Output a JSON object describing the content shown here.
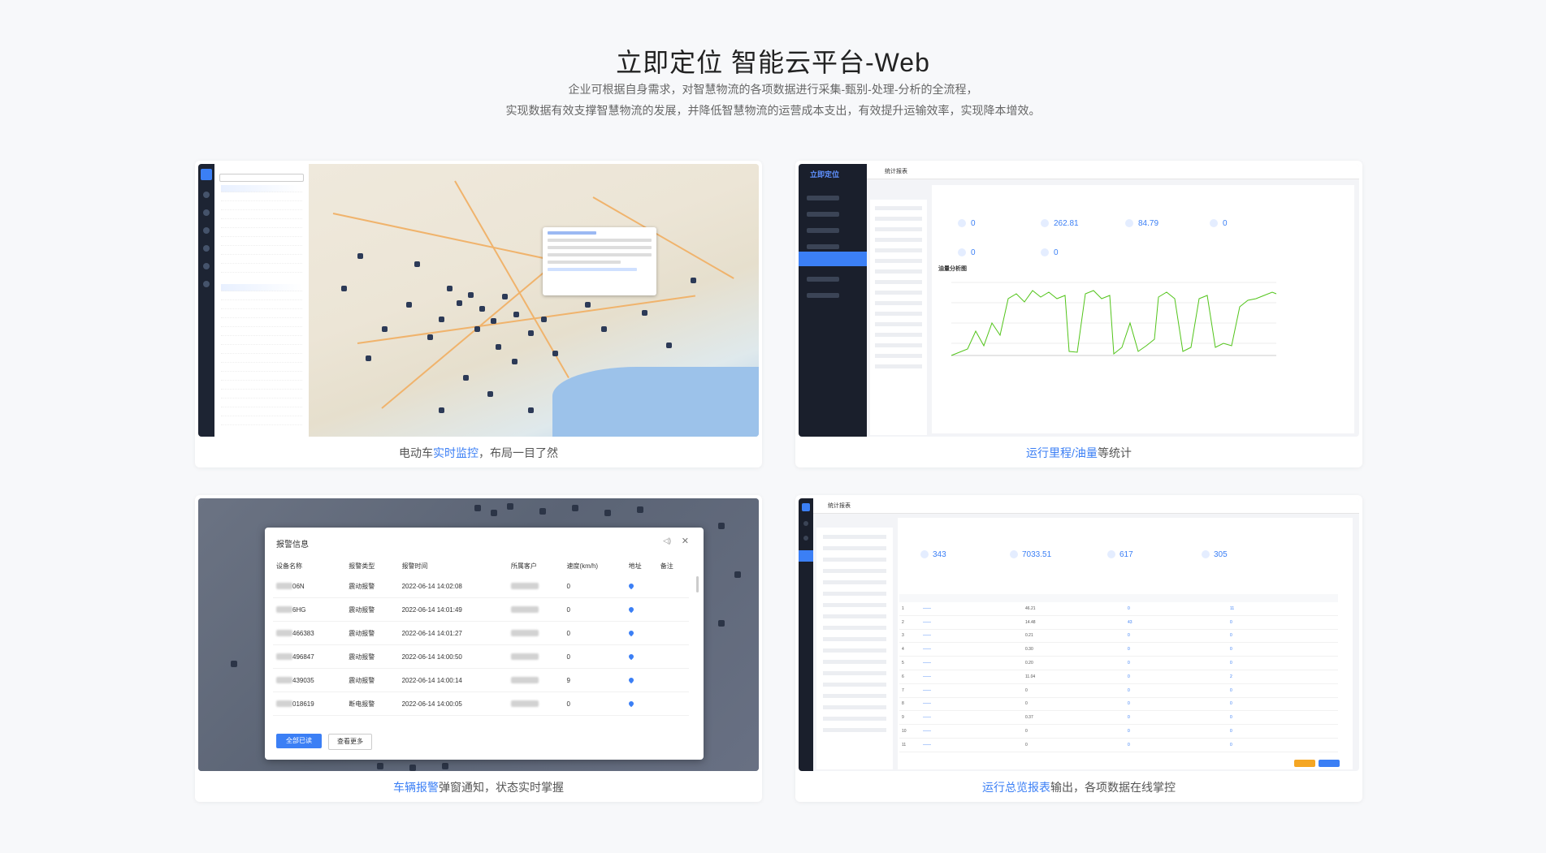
{
  "header": {
    "title": "立即定位 智能云平台-Web",
    "subtitle_line1": "企业可根据自身需求，对智慧物流的各项数据进行采集-甄别-处理-分析的全流程，",
    "subtitle_line2": "实现数据有效支撑智慧物流的发展，并降低智慧物流的运营成本支出，有效提升运输效率，实现降本增效。"
  },
  "cards": [
    {
      "caption_pre": "电动车",
      "caption_hl": "实时监控",
      "caption_post": "，布局一目了然"
    },
    {
      "caption_pre": "",
      "caption_hl": "运行里程/油量",
      "caption_post": "等统计"
    },
    {
      "caption_pre": "",
      "caption_hl": "车辆报警",
      "caption_post": "弹窗通知，状态实时掌握"
    },
    {
      "caption_pre": "",
      "caption_hl": "运行总览报表",
      "caption_post": "输出，各项数据在线掌控"
    }
  ],
  "chart_panel": {
    "brand": "立即定位",
    "page_title": "统计报表",
    "kpis": [
      "0",
      "262.81",
      "84.79",
      "0",
      "0",
      "0"
    ],
    "chart_title": "油量分析图"
  },
  "alarm_dialog": {
    "title": "报警信息",
    "columns": [
      "设备名称",
      "报警类型",
      "报警时间",
      "所属客户",
      "速度(km/h)",
      "地址",
      "备注"
    ],
    "rows": [
      {
        "name": "06N",
        "type": "震动报警",
        "time": "2022-06-14 14:02:08",
        "speed": "0"
      },
      {
        "name": "6HG",
        "type": "震动报警",
        "time": "2022-06-14 14:01:49",
        "speed": "0"
      },
      {
        "name": "466383",
        "type": "震动报警",
        "time": "2022-06-14 14:01:27",
        "speed": "0"
      },
      {
        "name": "496847",
        "type": "震动报警",
        "time": "2022-06-14 14:00:50",
        "speed": "0"
      },
      {
        "name": "439035",
        "type": "震动报警",
        "time": "2022-06-14 14:00:14",
        "speed": "9"
      },
      {
        "name": "018619",
        "type": "断电报警",
        "time": "2022-06-14 14:00:05",
        "speed": "0"
      }
    ],
    "btn_read_all": "全部已读",
    "btn_more": "查看更多"
  },
  "report_panel": {
    "page_title": "统计报表",
    "kpis": [
      "343",
      "7033.51",
      "617",
      "305"
    ],
    "rows": [
      [
        "1",
        "46.21",
        "0",
        "11"
      ],
      [
        "2",
        "14.48",
        "43",
        "0"
      ],
      [
        "3",
        "0.21",
        "0",
        "0"
      ],
      [
        "4",
        "0.30",
        "0",
        "0"
      ],
      [
        "5",
        "0.20",
        "0",
        "0"
      ],
      [
        "6",
        "11.04",
        "0",
        "2"
      ],
      [
        "7",
        "0",
        "0",
        "0"
      ],
      [
        "8",
        "0",
        "0",
        "0"
      ],
      [
        "9",
        "0.37",
        "0",
        "0"
      ],
      [
        "10",
        "0",
        "0",
        "0"
      ],
      [
        "11",
        "0",
        "0",
        "0"
      ]
    ]
  },
  "colors": {
    "accent": "#3b7ff5",
    "background": "#f7f8fa",
    "sidebar_dark": "#1a1f2c"
  }
}
